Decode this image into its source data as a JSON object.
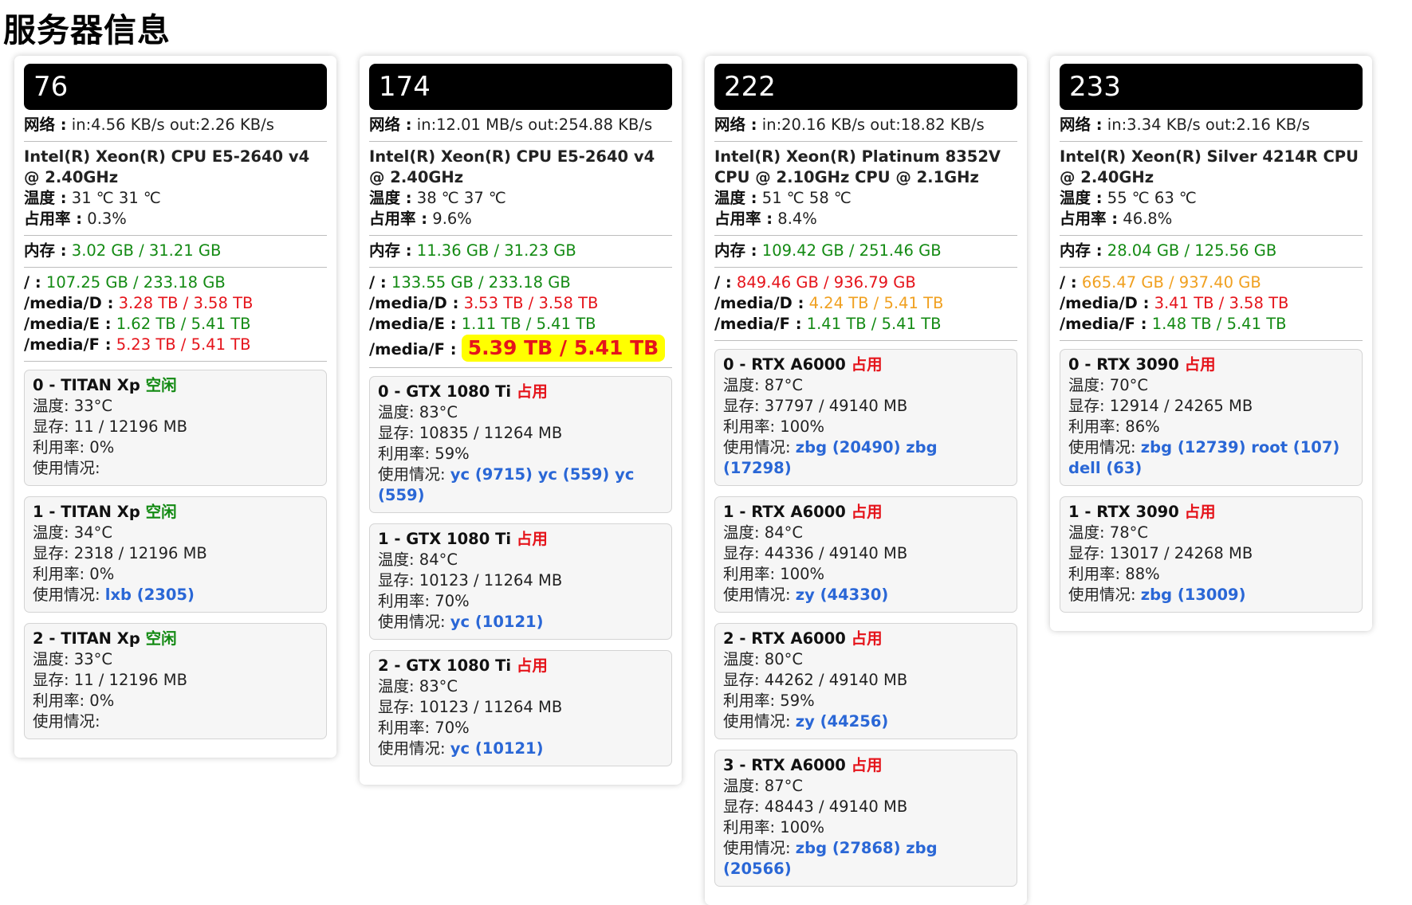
{
  "page_title": "服务器信息",
  "labels": {
    "network": "网络 :",
    "temperature": "温度 :",
    "cpu_usage": "占用率 :",
    "memory": "内存 :",
    "gpu_temp": "温度: ",
    "gpu_mem": "显存: ",
    "gpu_util": "利用率: ",
    "gpu_usage": "使用情况: "
  },
  "colors": {
    "green": "#138a13",
    "red": "#e5141b",
    "orange": "#f0a020",
    "blue": "#2a67d6",
    "highlight": "#ffff00"
  },
  "servers": [
    {
      "name": "76",
      "network": "in:4.56 KB/s out:2.26 KB/s",
      "cpu_model": "Intel(R) Xeon(R) CPU E5-2640 v4 @ 2.40GHz",
      "cpu_temp": "31 ℃ 31 ℃",
      "cpu_usage": "0.3%",
      "memory": "3.02 GB / 31.21 GB",
      "memory_color": "green",
      "disks": [
        {
          "mount": "/ :",
          "usage": "107.25 GB / 233.18 GB",
          "color": "green"
        },
        {
          "mount": "/media/D :",
          "usage": "3.28 TB / 3.58 TB",
          "color": "red"
        },
        {
          "mount": "/media/E :",
          "usage": "1.62 TB / 5.41 TB",
          "color": "green"
        },
        {
          "mount": "/media/F :",
          "usage": "5.23 TB / 5.41 TB",
          "color": "red"
        }
      ],
      "gpus": [
        {
          "title": "0 - TITAN Xp",
          "status": "空闲",
          "status_type": "free",
          "temp": "33°C",
          "mem": "11 / 12196 MB",
          "util": "0%",
          "procs": ""
        },
        {
          "title": "1 - TITAN Xp",
          "status": "空闲",
          "status_type": "free",
          "temp": "34°C",
          "mem": "2318 / 12196 MB",
          "util": "0%",
          "procs": "lxb (2305)"
        },
        {
          "title": "2 - TITAN Xp",
          "status": "空闲",
          "status_type": "free",
          "temp": "33°C",
          "mem": "11 / 12196 MB",
          "util": "0%",
          "procs": ""
        }
      ]
    },
    {
      "name": "174",
      "network": "in:12.01 MB/s out:254.88 KB/s",
      "cpu_model": "Intel(R) Xeon(R) CPU E5-2640 v4 @ 2.40GHz",
      "cpu_temp": "38 ℃ 37 ℃",
      "cpu_usage": "9.6%",
      "memory": "11.36 GB / 31.23 GB",
      "memory_color": "green",
      "disks": [
        {
          "mount": "/ :",
          "usage": "133.55 GB / 233.18 GB",
          "color": "green"
        },
        {
          "mount": "/media/D :",
          "usage": "3.53 TB / 3.58 TB",
          "color": "red"
        },
        {
          "mount": "/media/E :",
          "usage": "1.11 TB / 5.41 TB",
          "color": "green"
        },
        {
          "mount": "/media/F :",
          "usage": "5.39 TB / 5.41 TB",
          "color": "highlight"
        }
      ],
      "gpus": [
        {
          "title": "0 - GTX 1080 Ti",
          "status": "占用",
          "status_type": "busy",
          "temp": "83°C",
          "mem": "10835 / 11264 MB",
          "util": "59%",
          "procs": "yc (9715) yc (559) yc (559)"
        },
        {
          "title": "1 - GTX 1080 Ti",
          "status": "占用",
          "status_type": "busy",
          "temp": "84°C",
          "mem": "10123 / 11264 MB",
          "util": "70%",
          "procs": "yc (10121)"
        },
        {
          "title": "2 - GTX 1080 Ti",
          "status": "占用",
          "status_type": "busy",
          "temp": "83°C",
          "mem": "10123 / 11264 MB",
          "util": "70%",
          "procs": "yc (10121)"
        }
      ]
    },
    {
      "name": "222",
      "network": "in:20.16 KB/s out:18.82 KB/s",
      "cpu_model": "Intel(R) Xeon(R) Platinum 8352V CPU @ 2.10GHz CPU @ 2.1GHz",
      "cpu_temp": "51 ℃ 58 ℃",
      "cpu_usage": "8.4%",
      "memory": "109.42 GB / 251.46 GB",
      "memory_color": "green",
      "disks": [
        {
          "mount": "/ :",
          "usage": "849.46 GB / 936.79 GB",
          "color": "red"
        },
        {
          "mount": "/media/D :",
          "usage": "4.24 TB / 5.41 TB",
          "color": "orange"
        },
        {
          "mount": "/media/F :",
          "usage": "1.41 TB / 5.41 TB",
          "color": "green"
        }
      ],
      "gpus": [
        {
          "title": "0 - RTX A6000",
          "status": "占用",
          "status_type": "busy",
          "temp": "87°C",
          "mem": "37797 / 49140 MB",
          "util": "100%",
          "procs": "zbg (20490) zbg (17298)"
        },
        {
          "title": "1 - RTX A6000",
          "status": "占用",
          "status_type": "busy",
          "temp": "84°C",
          "mem": "44336 / 49140 MB",
          "util": "100%",
          "procs": "zy (44330)"
        },
        {
          "title": "2 - RTX A6000",
          "status": "占用",
          "status_type": "busy",
          "temp": "80°C",
          "mem": "44262 / 49140 MB",
          "util": "59%",
          "procs": "zy (44256)"
        },
        {
          "title": "3 - RTX A6000",
          "status": "占用",
          "status_type": "busy",
          "temp": "87°C",
          "mem": "48443 / 49140 MB",
          "util": "100%",
          "procs": "zbg (27868) zbg (20566)"
        }
      ]
    },
    {
      "name": "233",
      "network": "in:3.34 KB/s out:2.16 KB/s",
      "cpu_model": "Intel(R) Xeon(R) Silver 4214R CPU @ 2.40GHz",
      "cpu_temp": "55 ℃ 63 ℃",
      "cpu_usage": "46.8%",
      "memory": "28.04 GB / 125.56 GB",
      "memory_color": "green",
      "disks": [
        {
          "mount": "/ :",
          "usage": "665.47 GB / 937.40 GB",
          "color": "orange"
        },
        {
          "mount": "/media/D :",
          "usage": "3.41 TB / 3.58 TB",
          "color": "red"
        },
        {
          "mount": "/media/F :",
          "usage": "1.48 TB / 5.41 TB",
          "color": "green"
        }
      ],
      "gpus": [
        {
          "title": "0 - RTX 3090",
          "status": "占用",
          "status_type": "busy",
          "temp": "70°C",
          "mem": "12914 / 24265 MB",
          "util": "86%",
          "procs": "zbg (12739) root (107) dell (63)"
        },
        {
          "title": "1 - RTX 3090",
          "status": "占用",
          "status_type": "busy",
          "temp": "78°C",
          "mem": "13017 / 24268 MB",
          "util": "88%",
          "procs": "zbg (13009)"
        }
      ]
    }
  ]
}
